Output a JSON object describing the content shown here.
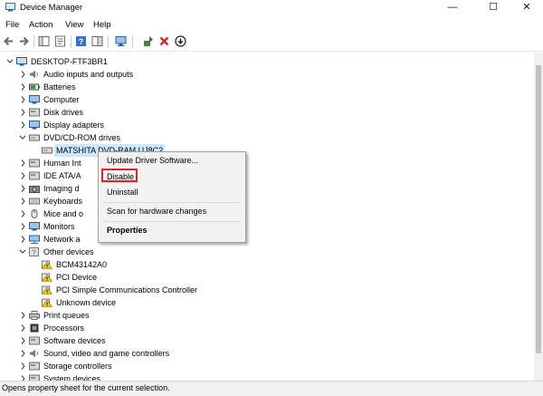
{
  "window": {
    "title": "Device Manager",
    "minimize_glyph": "—",
    "maximize_glyph": "☐",
    "close_glyph": "✕"
  },
  "menu": [
    "File",
    "Action",
    "View",
    "Help"
  ],
  "toolbar": [
    "back-icon",
    "forward-icon",
    "show-hide-tree-icon",
    "properties-icon",
    "help-icon",
    "action-pane-icon",
    "monitor-icon",
    "update-driver-icon",
    "uninstall-icon",
    "download-icon"
  ],
  "tree": {
    "root": "DESKTOP-FTF3BR1",
    "items": [
      {
        "label": "Audio inputs and outputs",
        "icon": "speaker-icon"
      },
      {
        "label": "Batteries",
        "icon": "battery-icon"
      },
      {
        "label": "Computer",
        "icon": "computer-icon"
      },
      {
        "label": "Disk drives",
        "icon": "disk-drive-icon"
      },
      {
        "label": "Display adapters",
        "icon": "display-adapter-icon"
      },
      {
        "label": "DVD/CD-ROM drives",
        "icon": "dvd-drive-icon"
      },
      {
        "label": "MATSHITA DVD-RAM UJ8C2",
        "icon": "dvd-drive-icon"
      },
      {
        "label": "Human Int",
        "icon": "hid-icon"
      },
      {
        "label": "IDE ATA/A",
        "icon": "ide-controller-icon"
      },
      {
        "label": "Imaging d",
        "icon": "camera-icon"
      },
      {
        "label": "Keyboards",
        "icon": "keyboard-icon"
      },
      {
        "label": "Mice and o",
        "icon": "mouse-icon"
      },
      {
        "label": "Monitors",
        "icon": "monitor-icon"
      },
      {
        "label": "Network a",
        "icon": "network-icon"
      },
      {
        "label": "Other devices",
        "icon": "unknown-device-icon"
      },
      {
        "label": "BCM43142A0",
        "icon": "warning-device-icon"
      },
      {
        "label": "PCI Device",
        "icon": "warning-device-icon"
      },
      {
        "label": "PCI Simple Communications Controller",
        "icon": "warning-device-icon"
      },
      {
        "label": "Unknown device",
        "icon": "warning-device-icon"
      },
      {
        "label": "Print queues",
        "icon": "printer-icon"
      },
      {
        "label": "Processors",
        "icon": "processor-icon"
      },
      {
        "label": "Software devices",
        "icon": "software-device-icon"
      },
      {
        "label": "Sound, video and game controllers",
        "icon": "sound-icon"
      },
      {
        "label": "Storage controllers",
        "icon": "storage-icon"
      },
      {
        "label": "System devices",
        "icon": "system-device-icon"
      }
    ]
  },
  "context_menu": {
    "update": "Update Driver Software...",
    "disable": "Disable",
    "uninstall": "Uninstall",
    "scan": "Scan for hardware changes",
    "properties": "Properties"
  },
  "status": "Opens property sheet for the current selection.",
  "colors": {
    "selection": "#cce8ff",
    "highlight_box": "#e0202b",
    "menu_bg": "#f2f2f2",
    "warning": "#f2c811"
  }
}
